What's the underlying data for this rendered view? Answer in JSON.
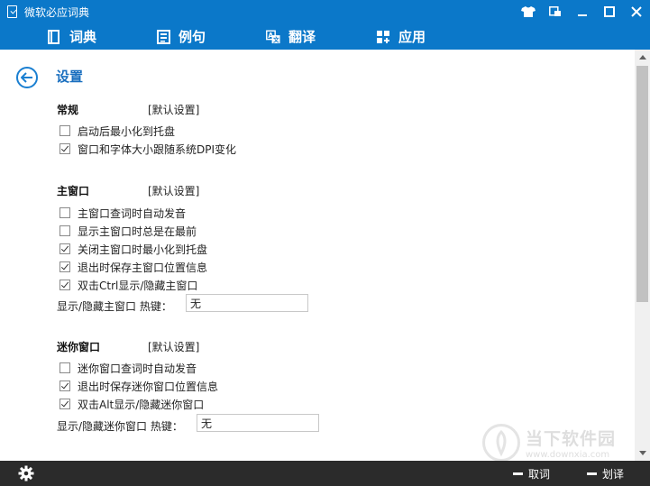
{
  "window": {
    "title": "微软必应词典"
  },
  "nav": {
    "tabs": [
      {
        "label": "词典",
        "icon": "book-icon"
      },
      {
        "label": "例句",
        "icon": "document-list-icon"
      },
      {
        "label": "翻译",
        "icon": "translate-icon"
      },
      {
        "label": "应用",
        "icon": "apps-grid-icon"
      }
    ]
  },
  "page": {
    "title": "设置"
  },
  "sections": {
    "general": {
      "title": "常规",
      "default_label": "[默认设置]",
      "options": [
        {
          "label": "启动后最小化到托盘",
          "checked": false
        },
        {
          "label": "窗口和字体大小跟随系统DPI变化",
          "checked": true
        }
      ]
    },
    "main_window": {
      "title": "主窗口",
      "default_label": "[默认设置]",
      "options": [
        {
          "label": "主窗口查词时自动发音",
          "checked": false
        },
        {
          "label": "显示主窗口时总是在最前",
          "checked": false
        },
        {
          "label": "关闭主窗口时最小化到托盘",
          "checked": true
        },
        {
          "label": "退出时保存主窗口位置信息",
          "checked": true
        },
        {
          "label": "双击Ctrl显示/隐藏主窗口",
          "checked": true
        }
      ],
      "hotkey_label": "显示/隐藏主窗口 热键：",
      "hotkey_value": "无"
    },
    "mini_window": {
      "title": "迷你窗口",
      "default_label": "[默认设置]",
      "options": [
        {
          "label": "迷你窗口查词时自动发音",
          "checked": false
        },
        {
          "label": "退出时保存迷你窗口位置信息",
          "checked": true
        },
        {
          "label": "双击Alt显示/隐藏迷你窗口",
          "checked": true
        }
      ],
      "hotkey_label": "显示/隐藏迷你窗口 热键：",
      "hotkey_value": "无"
    }
  },
  "bottom": {
    "lookup_label": "取词",
    "translate_label": "划译"
  },
  "watermark": {
    "cn": "当下软件园",
    "en": "www.downxia.com"
  },
  "colors": {
    "accent": "#0b78c9",
    "bottom_bar": "#2b2b2b",
    "title_text": "#1a6fbf"
  }
}
